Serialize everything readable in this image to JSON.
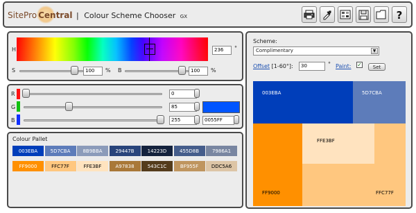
{
  "header": {
    "logo_sitepro": "SitePro",
    "logo_central": "Central",
    "separator": "|",
    "title": "Colour Scheme Chooser",
    "title_suffix": "GX",
    "toolbar_icons": [
      "printer-icon",
      "eyedropper-icon",
      "swatch-sheet-icon",
      "save-icon",
      "folder-icon",
      "help-icon"
    ]
  },
  "hsb": {
    "h_label": "H",
    "h_value": "236",
    "h_unit": "°",
    "s_label": "S",
    "s_value": "100",
    "s_unit": "%",
    "b_label": "B",
    "b_value": "100",
    "b_unit": "%",
    "hue": 236,
    "saturation": 100,
    "brightness": 100
  },
  "rgb": {
    "r_label": "R",
    "g_label": "G",
    "b_label": "B",
    "r_value": "0",
    "g_value": "85",
    "b_value": "255",
    "r": 0,
    "g": 85,
    "b": 255,
    "hex_value": "0055FF",
    "preview_color": "#0055FF"
  },
  "pallet": {
    "title": "Colour Pallet",
    "row1": [
      {
        "label": "003EBA",
        "color": "#003EBA",
        "text": "#ffffff"
      },
      {
        "label": "5D7CBA",
        "color": "#5D7CBA",
        "text": "#ffffff"
      },
      {
        "label": "8B9BBA",
        "color": "#8B9BBA",
        "text": "#ffffff"
      },
      {
        "label": "29447B",
        "color": "#29447B",
        "text": "#ffffff"
      },
      {
        "label": "14223D",
        "color": "#14223D",
        "text": "#ffffff"
      },
      {
        "label": "455D8B",
        "color": "#455D8B",
        "text": "#ffffff"
      },
      {
        "label": "7986A1",
        "color": "#7986A1",
        "text": "#ffffff"
      }
    ],
    "row2": [
      {
        "label": "FF9000",
        "color": "#FF9000",
        "text": "#ffffff"
      },
      {
        "label": "FFC77F",
        "color": "#FFC77F",
        "text": "#000000"
      },
      {
        "label": "FFE3BF",
        "color": "#FFE3BF",
        "text": "#000000"
      },
      {
        "label": "A97838",
        "color": "#A97838",
        "text": "#ffffff"
      },
      {
        "label": "543C1C",
        "color": "#543C1C",
        "text": "#ffffff"
      },
      {
        "label": "BF955F",
        "color": "#BF955F",
        "text": "#ffffff"
      },
      {
        "label": "DDC5A6",
        "color": "#DDC5A6",
        "text": "#000000"
      }
    ]
  },
  "scheme": {
    "label": "Scheme:",
    "selected": "Complimentary",
    "offset_label": "Offset",
    "offset_range": "[1-60°]:",
    "offset_value": "30",
    "offset_unit": "°",
    "paint_label": "Paint:",
    "paint_checked": true,
    "checkmark": "✓",
    "set_button": "Set",
    "dropdown_arrow": "▼",
    "preview": {
      "main": {
        "label": "003EBA",
        "color": "#003EBA"
      },
      "secondary": {
        "label": "5D7CBA",
        "color": "#5D7CBA"
      },
      "comp_main": {
        "label": "FF9000",
        "color": "#FF9000"
      },
      "comp_light": {
        "label": "FFE3BF",
        "color": "#FFE3BF"
      },
      "comp_mid": {
        "label": "FFC77F",
        "color": "#FFC77F"
      }
    }
  }
}
